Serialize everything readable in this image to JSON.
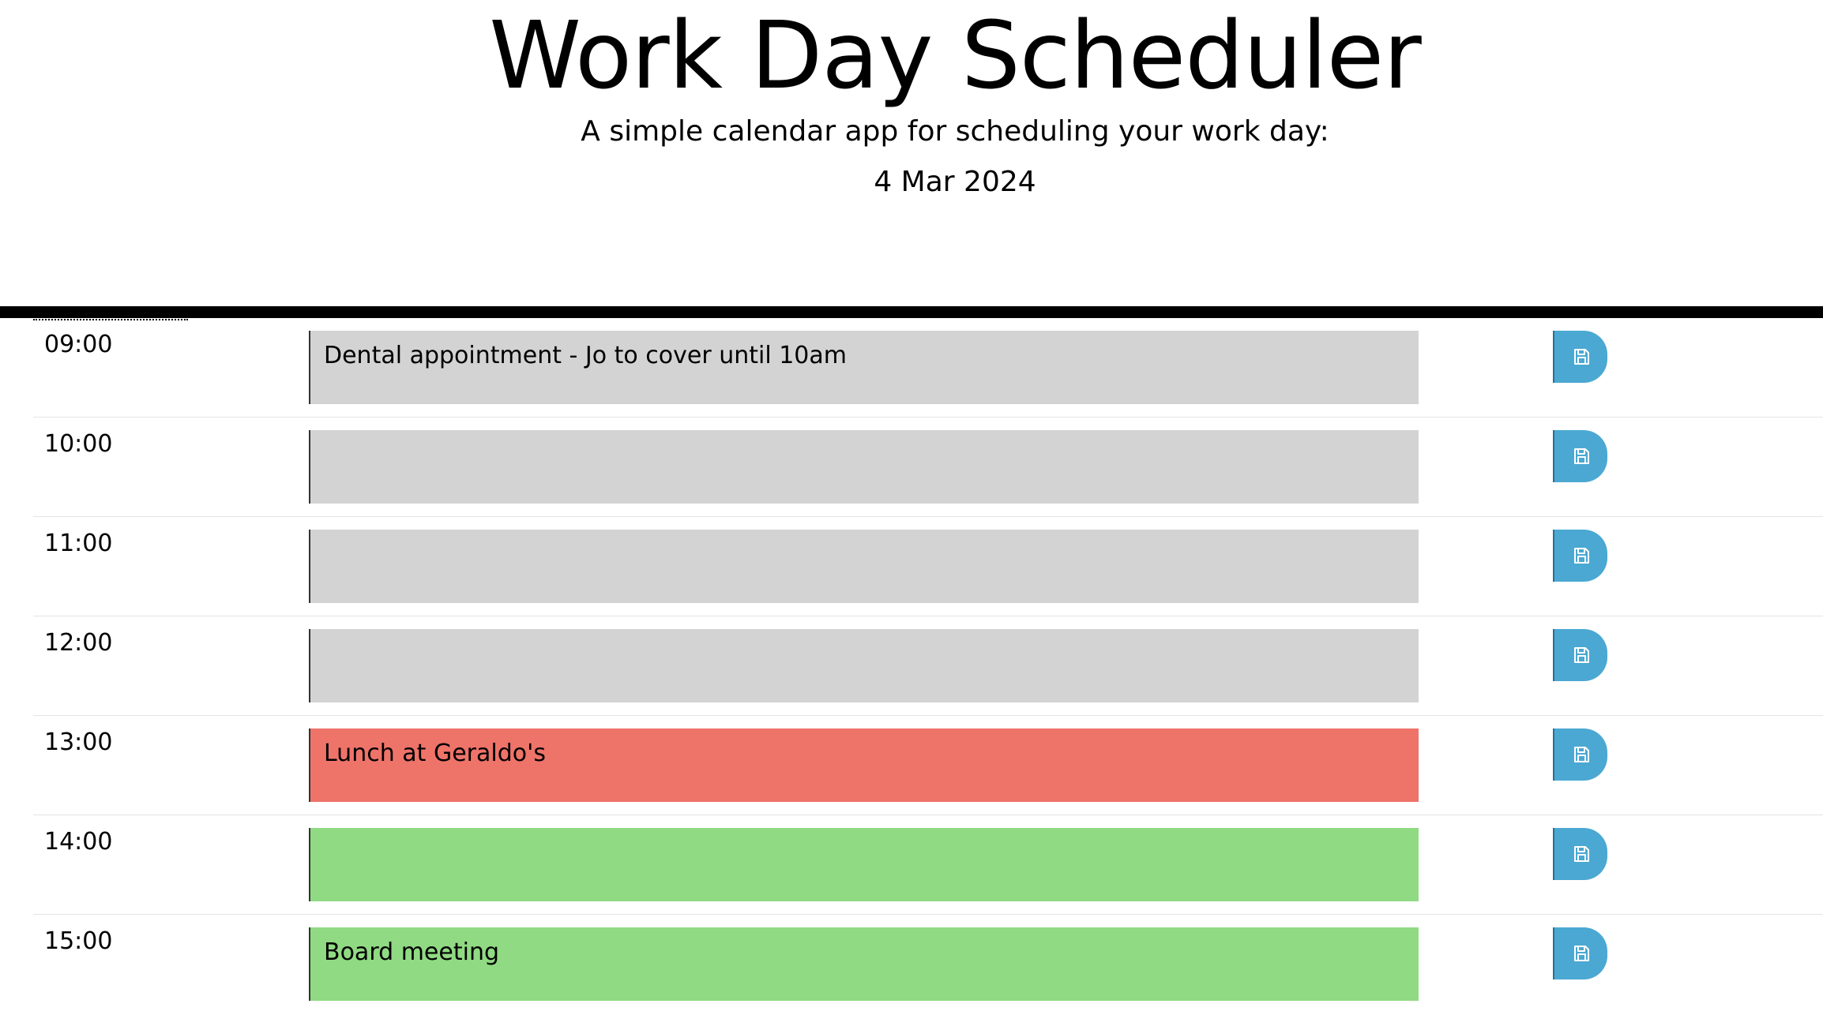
{
  "header": {
    "title": "Work Day Scheduler",
    "subtitle": "A simple calendar app for scheduling your work day:",
    "current_date": "4 Mar 2024"
  },
  "colors": {
    "past": "#d3d3d3",
    "present": "#ee7369",
    "future": "#90da83",
    "save_button": "#4ba8d2"
  },
  "time_blocks": [
    {
      "hour": "09:00",
      "text": "Dental appointment - Jo to cover until 10am",
      "state": "past",
      "save_icon": "floppy-disk-icon"
    },
    {
      "hour": "10:00",
      "text": "",
      "state": "past",
      "save_icon": "floppy-disk-icon"
    },
    {
      "hour": "11:00",
      "text": "",
      "state": "past",
      "save_icon": "floppy-disk-icon"
    },
    {
      "hour": "12:00",
      "text": "",
      "state": "past",
      "save_icon": "floppy-disk-icon"
    },
    {
      "hour": "13:00",
      "text": "Lunch at Geraldo's",
      "state": "present",
      "save_icon": "floppy-disk-icon"
    },
    {
      "hour": "14:00",
      "text": "",
      "state": "future",
      "save_icon": "floppy-disk-icon"
    },
    {
      "hour": "15:00",
      "text": "Board meeting",
      "state": "future",
      "save_icon": "floppy-disk-icon"
    }
  ]
}
